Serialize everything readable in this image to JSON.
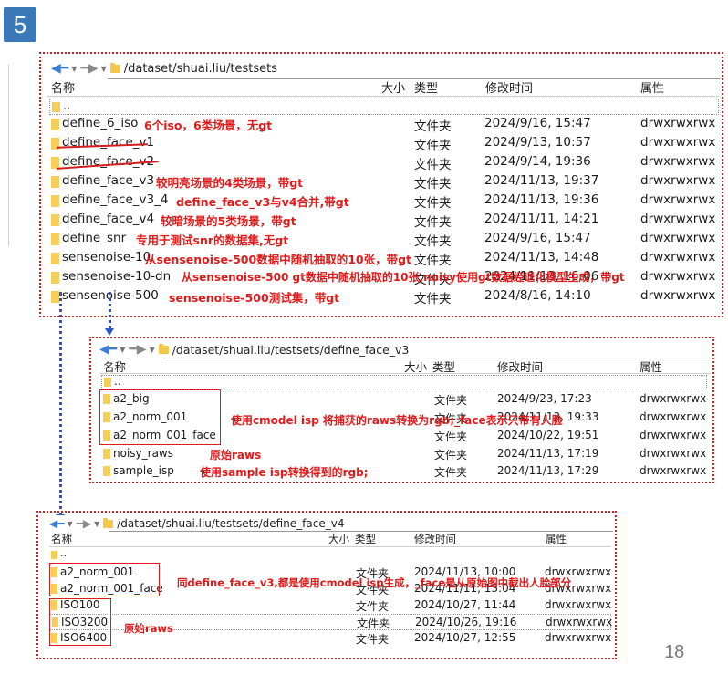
{
  "slide": {
    "badge": "5",
    "page_number": "18"
  },
  "panel1": {
    "path": "/dataset/shuai.liu/testsets",
    "headers": {
      "name": "名称",
      "size": "大小",
      "type": "类型",
      "modified": "修改时间",
      "attr": "属性"
    },
    "parent": "..",
    "rows": [
      {
        "name": "define_6_iso",
        "type": "文件夹",
        "modified": "2024/9/16, 15:47",
        "attr": "drwxrwxrwx",
        "note": "6个iso，6类场景，无gt"
      },
      {
        "name": "define_face_v1",
        "type": "文件夹",
        "modified": "2024/9/13, 10:57",
        "attr": "drwxrwxrwx",
        "note": ""
      },
      {
        "name": "define_face_v2",
        "type": "文件夹",
        "modified": "2024/9/14, 19:36",
        "attr": "drwxrwxrwx",
        "note": ""
      },
      {
        "name": "define_face_v3",
        "type": "文件夹",
        "modified": "2024/11/13, 19:37",
        "attr": "drwxrwxrwx",
        "note": "较明亮场景的4类场景，带gt"
      },
      {
        "name": "define_face_v3_4",
        "type": "文件夹",
        "modified": "2024/11/13, 19:36",
        "attr": "drwxrwxrwx",
        "note": "define_face_v3与v4合并,带gt"
      },
      {
        "name": "define_face_v4",
        "type": "文件夹",
        "modified": "2024/11/11, 14:21",
        "attr": "drwxrwxrwx",
        "note": "较暗场景的5类场景，带gt"
      },
      {
        "name": "define_snr",
        "type": "文件夹",
        "modified": "2024/9/16, 15:47",
        "attr": "drwxrwxrwx",
        "note": "专用于测试snr的数据集,无gt"
      },
      {
        "name": "sensenoise-10",
        "type": "文件夹",
        "modified": "2024/11/13, 14:48",
        "attr": "drwxrwxrwx",
        "note": "从sensenoise-500数据中随机抽取的10张，带gt"
      },
      {
        "name": "sensenoise-10-dn",
        "type": "文件夹",
        "modified": "2024/11/13, 16:06",
        "attr": "drwxrwxrwx",
        "note": "从sensenoise-500 gt数据中随机抽取的10张,noisy使用gt数据经退化模型生成，带gt"
      },
      {
        "name": "sensenoise-500",
        "type": "文件夹",
        "modified": "2024/8/16, 14:10",
        "attr": "drwxrwxrwx",
        "note": "sensenoise-500测试集，带gt"
      }
    ]
  },
  "panel2": {
    "path": "/dataset/shuai.liu/testsets/define_face_v3",
    "headers": {
      "name": "名称",
      "size": "大小",
      "type": "类型",
      "modified": "修改时间",
      "attr": "属性"
    },
    "parent": "..",
    "rows": [
      {
        "name": "a2_big",
        "type": "文件夹",
        "modified": "2024/9/23, 17:23",
        "attr": "drwxrwxrwx"
      },
      {
        "name": "a2_norm_001",
        "type": "文件夹",
        "modified": "2024/11/13, 19:33",
        "attr": "drwxrwxrwx"
      },
      {
        "name": "a2_norm_001_face",
        "type": "文件夹",
        "modified": "2024/10/22, 19:51",
        "attr": "drwxrwxrwx"
      },
      {
        "name": "noisy_raws",
        "type": "文件夹",
        "modified": "2024/11/13, 17:19",
        "attr": "drwxrwxrwx"
      },
      {
        "name": "sample_isp",
        "type": "文件夹",
        "modified": "2024/11/13, 17:29",
        "attr": "drwxrwxrwx"
      }
    ],
    "notes": {
      "cmodel": "使用cmodel isp 将捕获的raws转换为rgb;_face表示只带有人脸",
      "raws": "原始raws",
      "sample": "使用sample isp转换得到的rgb;"
    }
  },
  "panel3": {
    "path": "/dataset/shuai.liu/testsets/define_face_v4",
    "headers": {
      "name": "名称",
      "size": "大小",
      "type": "类型",
      "modified": "修改时间",
      "attr": "属性"
    },
    "parent": "..",
    "rows": [
      {
        "name": "a2_norm_001",
        "type": "文件夹",
        "modified": "2024/11/13, 10:00",
        "attr": "drwxrwxrwx"
      },
      {
        "name": "a2_norm_001_face",
        "type": "文件夹",
        "modified": "2024/11/11, 13:04",
        "attr": "drwxrwxrwx"
      },
      {
        "name": "ISO100",
        "type": "文件夹",
        "modified": "2024/10/27, 11:44",
        "attr": "drwxrwxrwx"
      },
      {
        "name": "ISO3200",
        "type": "文件夹",
        "modified": "2024/10/26, 19:16",
        "attr": "drwxrwxrwx"
      },
      {
        "name": "ISO6400",
        "type": "文件夹",
        "modified": "2024/10/27, 12:55",
        "attr": "drwxrwxrwx"
      }
    ],
    "notes": {
      "same": "同define_face_v3,都是使用cmodel isp生成，_face是从原始图中截出人脸部分",
      "raws": "原始raws"
    }
  }
}
